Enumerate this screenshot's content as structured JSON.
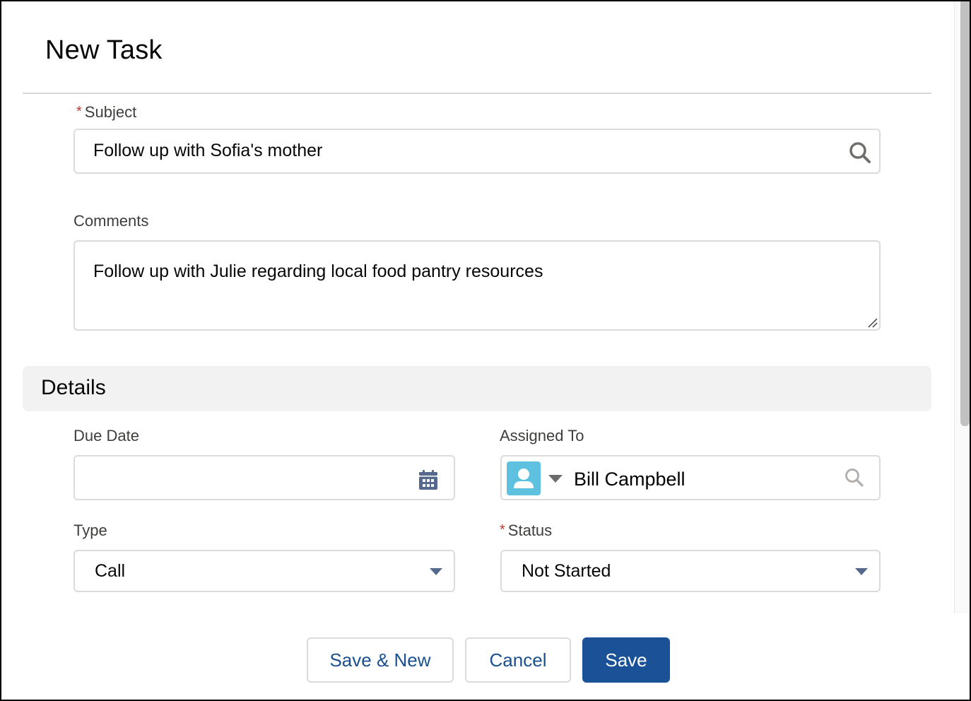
{
  "modal": {
    "title": "New Task"
  },
  "fields": {
    "subject": {
      "label": "Subject",
      "required_marker": "*",
      "value": "Follow up with Sofia's mother",
      "icon": "search-icon"
    },
    "comments": {
      "label": "Comments",
      "value": "Follow up with Julie regarding local food pantry resources"
    }
  },
  "details": {
    "section_title": "Details",
    "due_date": {
      "label": "Due Date",
      "value": "",
      "icon": "calendar-icon"
    },
    "assigned_to": {
      "label": "Assigned To",
      "value": "Bill Campbell",
      "avatar_icon": "user-icon",
      "avatar_color": "#5ec1e0",
      "icon": "search-icon"
    },
    "type": {
      "label": "Type",
      "value": "Call"
    },
    "status": {
      "label": "Status",
      "required_marker": "*",
      "value": "Not Started"
    }
  },
  "footer": {
    "save_new_label": "Save & New",
    "cancel_label": "Cancel",
    "save_label": "Save"
  },
  "colors": {
    "brand": "#1b5297",
    "required": "#c23934",
    "section_bg": "#f3f2f2"
  }
}
